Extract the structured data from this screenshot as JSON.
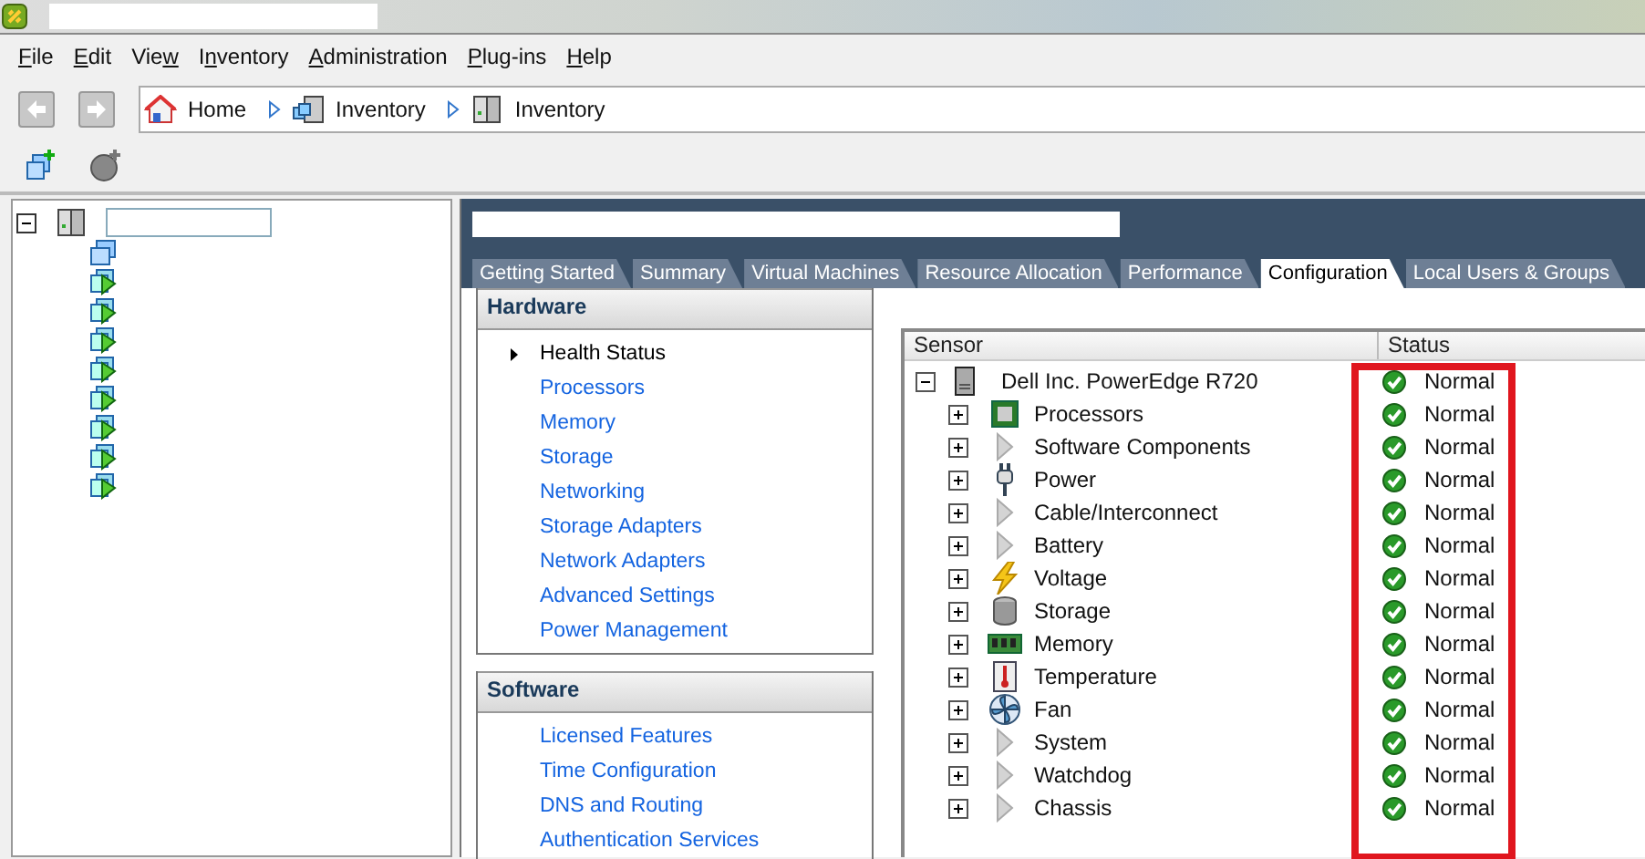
{
  "menu": [
    {
      "mnemonic": "F",
      "after": "ile"
    },
    {
      "mnemonic": "E",
      "after": "dit"
    },
    {
      "before": "Vie",
      "mnemonic": "w"
    },
    {
      "before": "I",
      "mnemonic": "n",
      "after": "ventory"
    },
    {
      "mnemonic": "A",
      "after": "dministration"
    },
    {
      "mnemonic": "P",
      "after": "lug-ins"
    },
    {
      "mnemonic": "H",
      "after": "elp"
    }
  ],
  "breadcrumb": [
    {
      "label": "Home",
      "kind": "home"
    },
    {
      "label": "Inventory",
      "kind": "datacenter"
    },
    {
      "label": "Inventory",
      "kind": "host"
    }
  ],
  "tree": {
    "kind": "host",
    "expanded": true,
    "children": [
      {
        "kind": "pool"
      },
      {
        "kind": "vm"
      },
      {
        "kind": "vm"
      },
      {
        "kind": "vm"
      },
      {
        "kind": "vm"
      },
      {
        "kind": "vm"
      },
      {
        "kind": "vm"
      },
      {
        "kind": "vm"
      },
      {
        "kind": "vm"
      }
    ]
  },
  "tabs": [
    {
      "label": "Getting Started",
      "selected": false
    },
    {
      "label": "Summary",
      "selected": false
    },
    {
      "label": "Virtual Machines",
      "selected": false
    },
    {
      "label": "Resource Allocation",
      "selected": false
    },
    {
      "label": "Performance",
      "selected": false
    },
    {
      "label": "Configuration",
      "selected": true
    },
    {
      "label": "Local Users & Groups",
      "selected": false
    }
  ],
  "sections": [
    {
      "title": "Hardware",
      "items": [
        {
          "label": "Health Status",
          "selected": true
        },
        {
          "label": "Processors",
          "selected": false
        },
        {
          "label": "Memory",
          "selected": false
        },
        {
          "label": "Storage",
          "selected": false
        },
        {
          "label": "Networking",
          "selected": false
        },
        {
          "label": "Storage Adapters",
          "selected": false
        },
        {
          "label": "Network Adapters",
          "selected": false
        },
        {
          "label": "Advanced Settings",
          "selected": false
        },
        {
          "label": "Power Management",
          "selected": false
        }
      ]
    },
    {
      "title": "Software",
      "items": [
        {
          "label": "Licensed Features",
          "selected": false
        },
        {
          "label": "Time Configuration",
          "selected": false
        },
        {
          "label": "DNS and Routing",
          "selected": false
        },
        {
          "label": "Authentication Services",
          "selected": false
        }
      ]
    }
  ],
  "sensors": {
    "columns": [
      "Sensor",
      "Status"
    ],
    "root": {
      "name": "Dell Inc. PowerEdge R720",
      "kind": "server",
      "status": "Normal",
      "expanded": true
    },
    "rows": [
      {
        "name": "Processors",
        "kind": "chip",
        "status": "Normal",
        "expanded": false
      },
      {
        "name": "Software Components",
        "kind": "generic",
        "status": "Normal",
        "expanded": false
      },
      {
        "name": "Power",
        "kind": "plug",
        "status": "Normal",
        "expanded": false
      },
      {
        "name": "Cable/Interconnect",
        "kind": "generic",
        "status": "Normal",
        "expanded": false
      },
      {
        "name": "Battery",
        "kind": "generic",
        "status": "Normal",
        "expanded": false
      },
      {
        "name": "Voltage",
        "kind": "bolt",
        "status": "Normal",
        "expanded": false
      },
      {
        "name": "Storage",
        "kind": "disk",
        "status": "Normal",
        "expanded": false
      },
      {
        "name": "Memory",
        "kind": "ram",
        "status": "Normal",
        "expanded": false
      },
      {
        "name": "Temperature",
        "kind": "thermo",
        "status": "Normal",
        "expanded": false
      },
      {
        "name": "Fan",
        "kind": "fan",
        "status": "Normal",
        "expanded": false
      },
      {
        "name": "System",
        "kind": "generic",
        "status": "Normal",
        "expanded": false
      },
      {
        "name": "Watchdog",
        "kind": "generic",
        "status": "Normal",
        "expanded": false
      },
      {
        "name": "Chassis",
        "kind": "generic",
        "status": "Normal",
        "expanded": false
      }
    ]
  }
}
